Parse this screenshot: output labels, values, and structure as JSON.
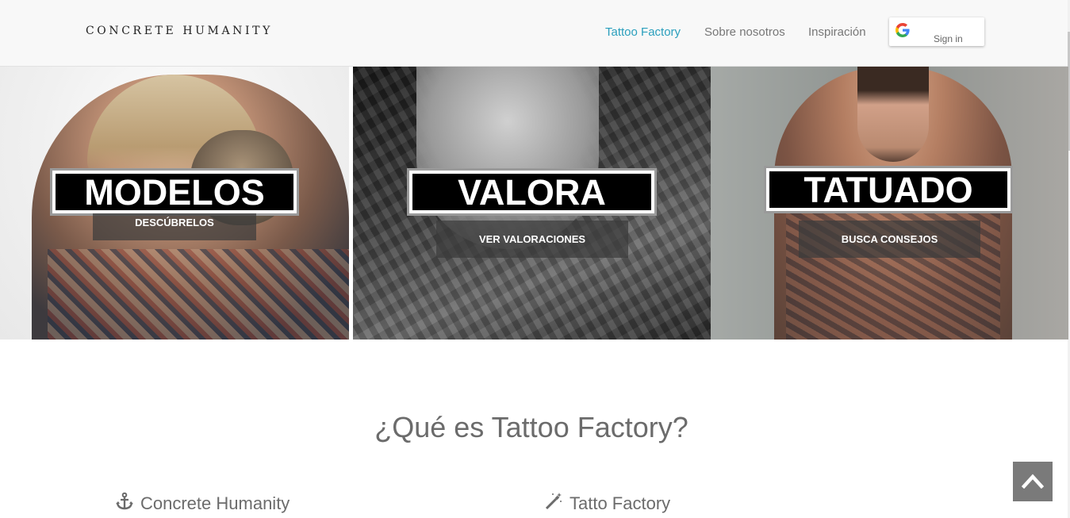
{
  "header": {
    "brand": "CONCRETE HUMANITY",
    "nav": [
      {
        "label": "Tattoo Factory"
      },
      {
        "label": "Sobre nosotros"
      },
      {
        "label": "Inspiración"
      }
    ],
    "signin_label": "Sign in",
    "colors": {
      "active_link": "#2a9fbd"
    }
  },
  "hero": [
    {
      "title": "MODELOS",
      "button": "DESCÚBRELOS"
    },
    {
      "title": "VALORA",
      "button": "VER VALORACIONES"
    },
    {
      "title": "TATUADO",
      "button": "BUSCA CONSEJOS"
    }
  ],
  "section": {
    "title": "¿Qué es Tattoo Factory?",
    "features": [
      {
        "icon": "anchor-icon",
        "label": "Concrete Humanity"
      },
      {
        "icon": "magic-wand-icon",
        "label": "Tatto Factory"
      }
    ]
  },
  "scroll_top_icon": "chevron-up-icon"
}
